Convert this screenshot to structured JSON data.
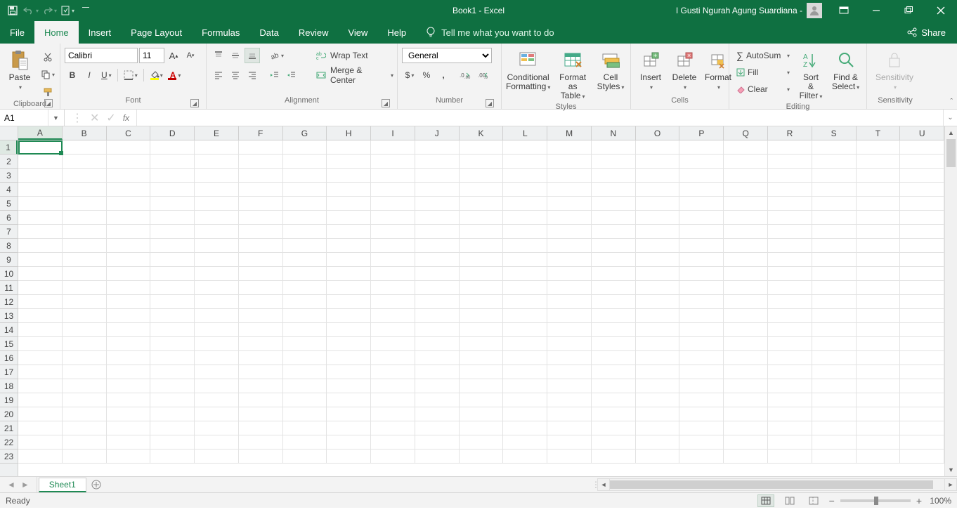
{
  "title": {
    "doc": "Book1",
    "sep": "  -  ",
    "app": "Excel"
  },
  "account": {
    "name": "I Gusti Ngurah Agung Suardiana -"
  },
  "menubar": {
    "tabs": [
      "File",
      "Home",
      "Insert",
      "Page Layout",
      "Formulas",
      "Data",
      "Review",
      "View",
      "Help"
    ],
    "active": 1,
    "tellme": "Tell me what you want to do",
    "share": "Share"
  },
  "ribbon": {
    "clipboard": {
      "label": "Clipboard",
      "paste": "Paste"
    },
    "font": {
      "label": "Font",
      "name": "Calibri",
      "size": "11"
    },
    "alignment": {
      "label": "Alignment",
      "wrap": "Wrap Text",
      "merge": "Merge & Center"
    },
    "number": {
      "label": "Number",
      "format": "General"
    },
    "styles": {
      "label": "Styles",
      "cond": "Conditional",
      "cond2": "Formatting",
      "fmt": "Format as",
      "fmt2": "Table",
      "cell": "Cell",
      "cell2": "Styles"
    },
    "cells": {
      "label": "Cells",
      "insert": "Insert",
      "delete": "Delete",
      "format": "Format"
    },
    "editing": {
      "label": "Editing",
      "autosum": "AutoSum",
      "fill": "Fill",
      "clear": "Clear",
      "sort": "Sort &",
      "sort2": "Filter",
      "find": "Find &",
      "find2": "Select"
    },
    "sensitivity": {
      "label": "Sensitivity",
      "btn": "Sensitivity"
    }
  },
  "namebox": "A1",
  "columns": [
    "A",
    "B",
    "C",
    "D",
    "E",
    "F",
    "G",
    "H",
    "I",
    "J",
    "K",
    "L",
    "M",
    "N",
    "O",
    "P",
    "Q",
    "R",
    "S",
    "T",
    "U"
  ],
  "rows": [
    "1",
    "2",
    "3",
    "4",
    "5",
    "6",
    "7",
    "8",
    "9",
    "10",
    "11",
    "12",
    "13",
    "14",
    "15",
    "16",
    "17",
    "18",
    "19",
    "20",
    "21",
    "22",
    "23"
  ],
  "sheets": {
    "active": "Sheet1"
  },
  "status": {
    "ready": "Ready",
    "zoom": "100%"
  }
}
